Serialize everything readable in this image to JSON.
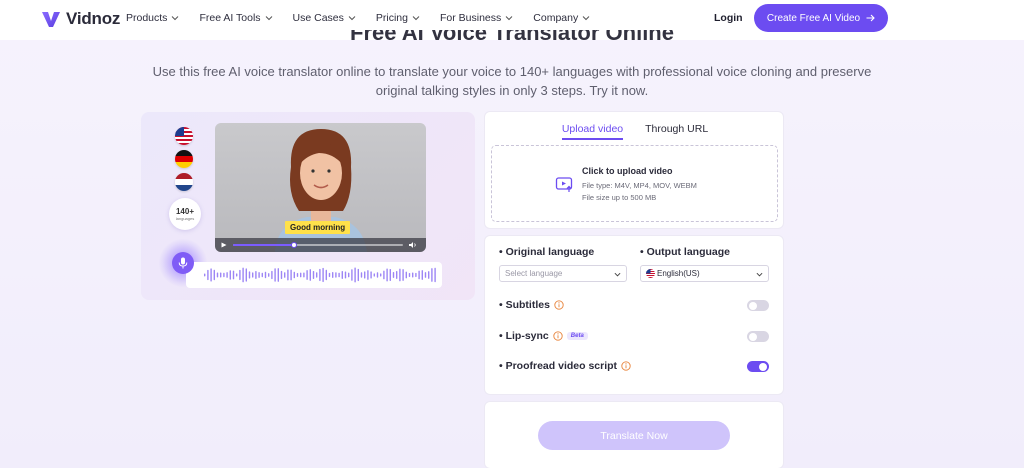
{
  "nav": {
    "brand": "Vidnoz",
    "menu": [
      {
        "label": "Products"
      },
      {
        "label": "Free AI Tools"
      },
      {
        "label": "Use Cases"
      },
      {
        "label": "Pricing"
      },
      {
        "label": "For Business"
      },
      {
        "label": "Company"
      }
    ],
    "login": "Login",
    "cta": "Create Free AI Video"
  },
  "hero": {
    "title": "Free AI Voice Translator Online",
    "subtitle": "Use this free AI voice translator online to translate your voice to 140+ languages with professional voice cloning and preserve original talking styles in only 3 steps. Try it now."
  },
  "demo": {
    "languages_count": "140+",
    "languages_label": "languages",
    "caption": "Good morning",
    "progress": 0.36
  },
  "upload": {
    "tabs": [
      {
        "label": "Upload video",
        "active": true
      },
      {
        "label": "Through URL",
        "active": false
      }
    ],
    "title": "Click to upload video",
    "file_types": "File type: M4V, MP4, MOV, WEBM",
    "file_size": "File size up to 500 MB"
  },
  "settings": {
    "original_language": {
      "label": "• Original language",
      "placeholder": "Select language"
    },
    "output_language": {
      "label": "• Output language",
      "value": "English(US)"
    },
    "subtitles": {
      "label": "• Subtitles",
      "enabled": false
    },
    "lip_sync": {
      "label": "• Lip-sync",
      "badge": "Beta",
      "enabled": false
    },
    "proofread": {
      "label": "• Proofread video script",
      "enabled": true
    }
  },
  "translate_button": "Translate Now",
  "colors": {
    "accent": "#6c4cf1",
    "button_disabled": "#cfc4fb",
    "info_icon": "#e8833a"
  }
}
